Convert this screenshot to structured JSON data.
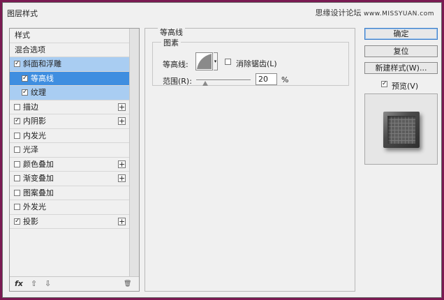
{
  "window": {
    "title": "图层样式",
    "watermark_cn": "思缘设计论坛",
    "watermark_url": "www.MISSYUAN.com",
    "close_glyph": "✕"
  },
  "styles": {
    "header": "样式",
    "blend_options": "混合选项",
    "items": [
      {
        "label": "斜面和浮雕",
        "checked": true
      },
      {
        "label": "等高线",
        "checked": true
      },
      {
        "label": "纹理",
        "checked": true
      },
      {
        "label": "描边",
        "checked": false
      },
      {
        "label": "内阴影",
        "checked": true
      },
      {
        "label": "内发光",
        "checked": false
      },
      {
        "label": "光泽",
        "checked": false
      },
      {
        "label": "颜色叠加",
        "checked": false
      },
      {
        "label": "渐变叠加",
        "checked": false
      },
      {
        "label": "图案叠加",
        "checked": false
      },
      {
        "label": "外发光",
        "checked": false
      },
      {
        "label": "投影",
        "checked": true
      }
    ],
    "fx_label": "fx"
  },
  "contour_section": {
    "title": "等高线",
    "group_title": "图素",
    "contour_label": "等高线:",
    "antialias_label": "消除锯齿(L)",
    "antialias_checked": false,
    "range_label": "范围(R):",
    "range_value": "20",
    "range_unit": "%",
    "range_fraction": 0.2
  },
  "buttons": {
    "ok": "确定",
    "reset": "复位",
    "new_style": "新建样式(W)...",
    "preview_label": "预览(V)",
    "preview_checked": true
  },
  "icons": {
    "check": "✓",
    "plus": "+",
    "up_arrow": "⇧",
    "down_arrow": "⇩",
    "trash": "🗑"
  }
}
